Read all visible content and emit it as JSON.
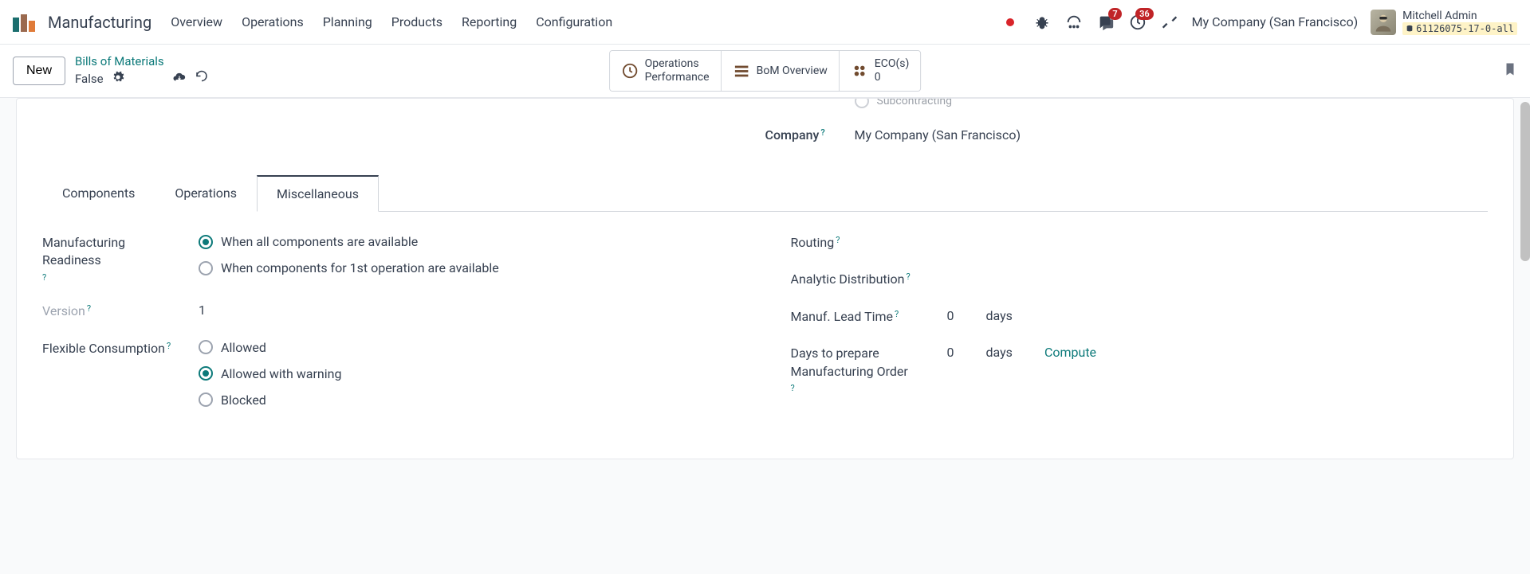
{
  "app": {
    "name": "Manufacturing"
  },
  "nav": {
    "items": [
      "Overview",
      "Operations",
      "Planning",
      "Products",
      "Reporting",
      "Configuration"
    ]
  },
  "topright": {
    "messages_badge": "7",
    "activities_badge": "36",
    "company": "My Company (San Francisco)",
    "user_name": "Mitchell Admin",
    "db_name": "61126075-17-0-all"
  },
  "subbar": {
    "new_label": "New",
    "breadcrumb_parent": "Bills of Materials",
    "breadcrumb_current": "False",
    "stat_ops_perf_l1": "Operations",
    "stat_ops_perf_l2": "Performance",
    "stat_bom_overview": "BoM Overview",
    "stat_eco_l1": "ECO(s)",
    "stat_eco_l2": "0"
  },
  "partial": {
    "subcontracting_label": "Subcontracting",
    "company_label": "Company",
    "company_value": "My Company (San Francisco)"
  },
  "tabs": {
    "components": "Components",
    "operations": "Operations",
    "misc": "Miscellaneous"
  },
  "misc": {
    "manuf_readiness_label": "Manufacturing Readiness",
    "readiness_all": "When all components are available",
    "readiness_first": "When components for 1st operation are available",
    "version_label": "Version",
    "version_value": "1",
    "flex_label": "Flexible Consumption",
    "flex_allowed": "Allowed",
    "flex_warning": "Allowed with warning",
    "flex_blocked": "Blocked",
    "routing_label": "Routing",
    "analytic_label": "Analytic Distribution",
    "lead_time_label": "Manuf. Lead Time",
    "lead_time_value": "0",
    "lead_time_unit": "days",
    "days_prepare_label": "Days to prepare Manufacturing Order",
    "days_prepare_value": "0",
    "days_prepare_unit": "days",
    "compute_label": "Compute"
  }
}
